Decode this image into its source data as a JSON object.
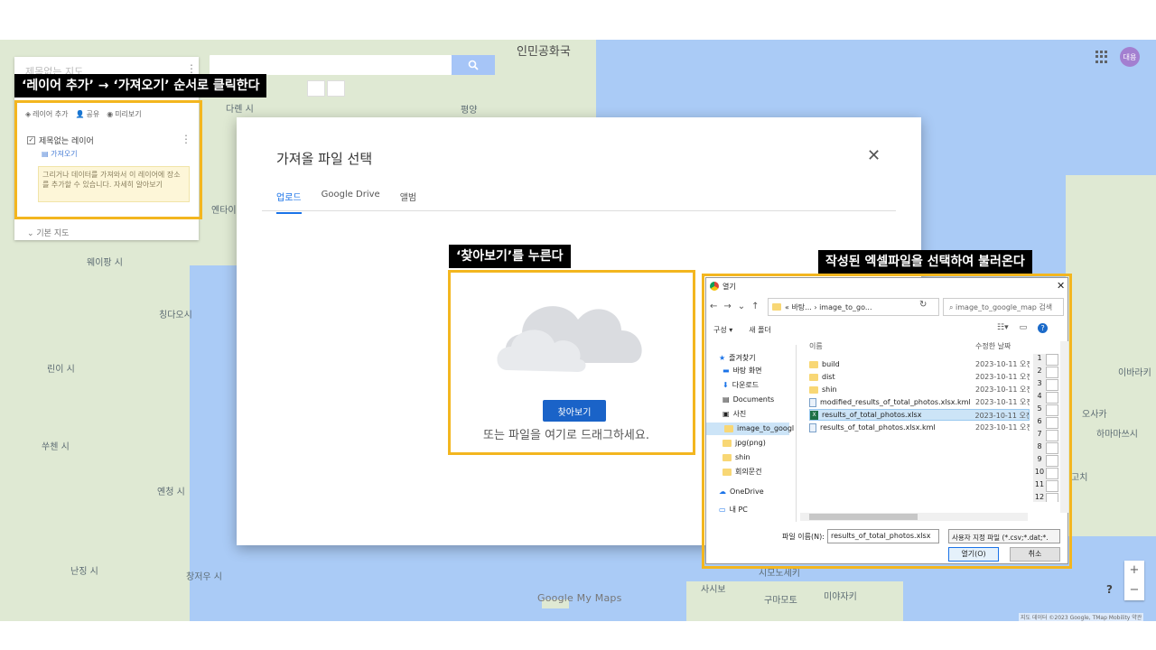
{
  "left_panel": {
    "title": "제목없는 지도",
    "actions": {
      "add_layer": "레이어 추가",
      "share": "공유",
      "preview": "미리보기"
    },
    "layer_name": "제목없는 레이어",
    "import_link": "가져오기",
    "hint": "그리거나 데이터를 가져와서 이 레이어에 장소를 추가할 수 있습니다. 자세히 알아보기",
    "base_map": "기본 지도"
  },
  "header": {
    "avatar_initials": "대용"
  },
  "callouts": {
    "step1": "‘레이어 추가’ → ‘가져오기’ 순서로 클릭한다",
    "step2": "‘찾아보기’를 누른다",
    "step3": "작성된 엑셀파일을 선택하여 불러온다"
  },
  "import_dialog": {
    "title": "가져올 파일 선택",
    "tabs": [
      "업로드",
      "Google Drive",
      "앨범"
    ],
    "browse_button": "찾아보기",
    "drag_text": "또는 파일을 여기로 드래그하세요."
  },
  "file_dialog": {
    "title": "열기",
    "path_text": "« 바탕... › image_to_go...",
    "search_placeholder": "image_to_google_map 검색",
    "organize": "구성 ▾",
    "new_folder": "새 폴더",
    "col_name": "이름",
    "col_date": "수정한 날짜",
    "tree": [
      "즐겨찾기",
      "바탕 화면",
      "다운로드",
      "Documents",
      "사진",
      "image_to_googl",
      "jpg(png)",
      "shin",
      "회의문건",
      "OneDrive",
      "내 PC"
    ],
    "files": [
      {
        "name": "build",
        "date": "2023-10-11 오전"
      },
      {
        "name": "dist",
        "date": "2023-10-11 오전"
      },
      {
        "name": "shin",
        "date": "2023-10-11 오전"
      },
      {
        "name": "modified_results_of_total_photos.xlsx.kml",
        "date": "2023-10-11 오전"
      },
      {
        "name": "results_of_total_photos.xlsx",
        "date": "2023-10-11 오전"
      },
      {
        "name": "results_of_total_photos.xlsx.kml",
        "date": "2023-10-11 오전"
      }
    ],
    "row_numbers": [
      "1",
      "2",
      "3",
      "4",
      "5",
      "6",
      "7",
      "8",
      "9",
      "10",
      "11",
      "12"
    ],
    "filename_label": "파일 이름(N):",
    "filename_value": "results_of_total_photos.xlsx",
    "filter": "사용자 지정 파일 (*.csv;*.dat;*.",
    "open_button": "열기(O)",
    "cancel_button": "취소"
  },
  "map": {
    "labels": [
      "인민공화국",
      "평양",
      "다롄 시",
      "옌타이",
      "웨이팡 시",
      "칭다오시",
      "린이 시",
      "쑤첸 시",
      "옌청 시",
      "난징 시",
      "창저우 시",
      "오사카",
      "이바라키",
      "고치",
      "사시보",
      "미야자키",
      "시모노세키",
      "구마모토",
      "하마마쓰시"
    ],
    "google_logo": "Google My Maps",
    "attribution": "지도 데이터 ©2023 Google, TMap Mobility  약관"
  }
}
